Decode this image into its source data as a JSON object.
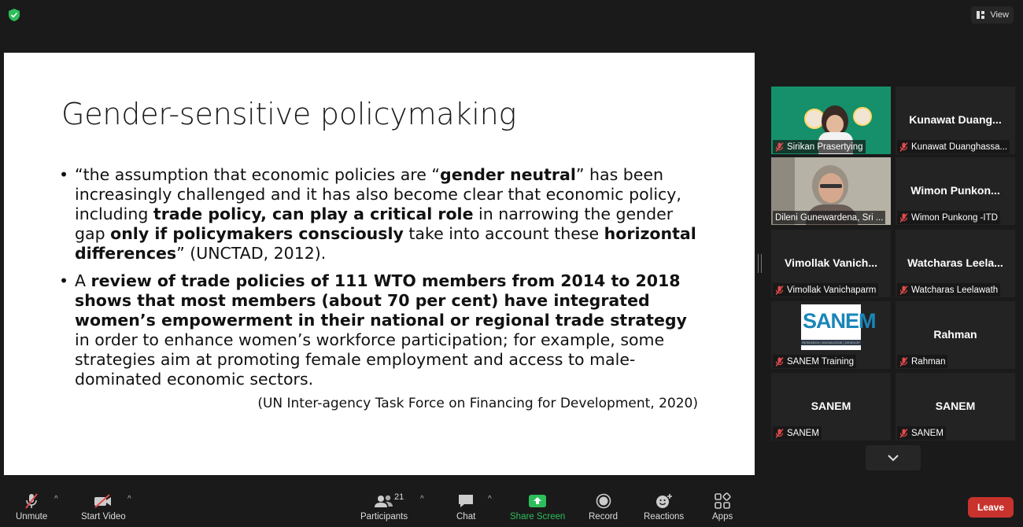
{
  "top_bar": {
    "view_label": "View"
  },
  "slide": {
    "title": "Gender-sensitive policymaking",
    "bullets": [
      {
        "segments": [
          {
            "text": "“the assumption that economic policies are “",
            "bold": false
          },
          {
            "text": "gender neutral",
            "bold": true
          },
          {
            "text": "” has been increasingly challenged and it has also become clear that economic policy, including ",
            "bold": false
          },
          {
            "text": "trade policy, can play a critical role",
            "bold": true
          },
          {
            "text": " in narrowing the gender gap ",
            "bold": false
          },
          {
            "text": "only if policymakers consciously",
            "bold": true
          },
          {
            "text": " take into account these ",
            "bold": false
          },
          {
            "text": "horizontal differences",
            "bold": true
          },
          {
            "text": "” (UNCTAD, 2012).",
            "bold": false
          }
        ]
      },
      {
        "segments": [
          {
            "text": "A ",
            "bold": false
          },
          {
            "text": "review of trade policies of 111 WTO members from 2014 to 2018 shows that most members (about 70 per cent) have integrated women’s empowerment in their national or regional trade strategy",
            "bold": true
          },
          {
            "text": " in order to enhance women’s workforce participation; for example, some strategies aim at promoting female employment and access to male-dominated economic sectors.",
            "bold": false
          }
        ]
      }
    ],
    "citation": "(UN Inter-agency Task Force on Financing for Development, 2020)"
  },
  "participants_panel": {
    "tiles": [
      {
        "display_name": "",
        "label": "Sirikan Prasertying",
        "video": "slide-share",
        "muted": true
      },
      {
        "display_name": "Kunawat  Duang...",
        "label": "Kunawat Duanghassa...",
        "video": "none",
        "muted": true
      },
      {
        "display_name": "",
        "label": "Dileni Gunewardena, Sri ...",
        "video": "camera",
        "muted": false,
        "active_speaker": true
      },
      {
        "display_name": "Wimon  Punkon...",
        "label": "Wimon Punkong -ITD",
        "video": "none",
        "muted": true
      },
      {
        "display_name": "Vimollak  Vanich...",
        "label": "Vimollak Vanichaparm",
        "video": "none",
        "muted": true
      },
      {
        "display_name": "Watcharas  Leela...",
        "label": "Watcharas Leelawath",
        "video": "none",
        "muted": true
      },
      {
        "display_name": "",
        "label": "SANEM Training",
        "video": "logo",
        "muted": true
      },
      {
        "display_name": "Rahman",
        "label": "Rahman",
        "video": "none",
        "muted": true
      },
      {
        "display_name": "SANEM",
        "label": "SANEM",
        "video": "none",
        "muted": true
      },
      {
        "display_name": "SANEM",
        "label": "SANEM",
        "video": "none",
        "muted": true
      }
    ],
    "logo_text": "SANEM",
    "logo_subtext": "RESEARCH | KNOWLEDGE | DEVELOP"
  },
  "toolbar": {
    "unmute": "Unmute",
    "start_video": "Start Video",
    "participants": "Participants",
    "participants_count": "21",
    "chat": "Chat",
    "share_screen": "Share Screen",
    "record": "Record",
    "reactions": "Reactions",
    "apps": "Apps",
    "leave": "Leave"
  },
  "colors": {
    "background": "#1a1a1a",
    "share_green": "#2dbd5a",
    "leave_red": "#c8332d",
    "active_speaker": "#e8e36a",
    "muted_red": "#e04b4b"
  }
}
